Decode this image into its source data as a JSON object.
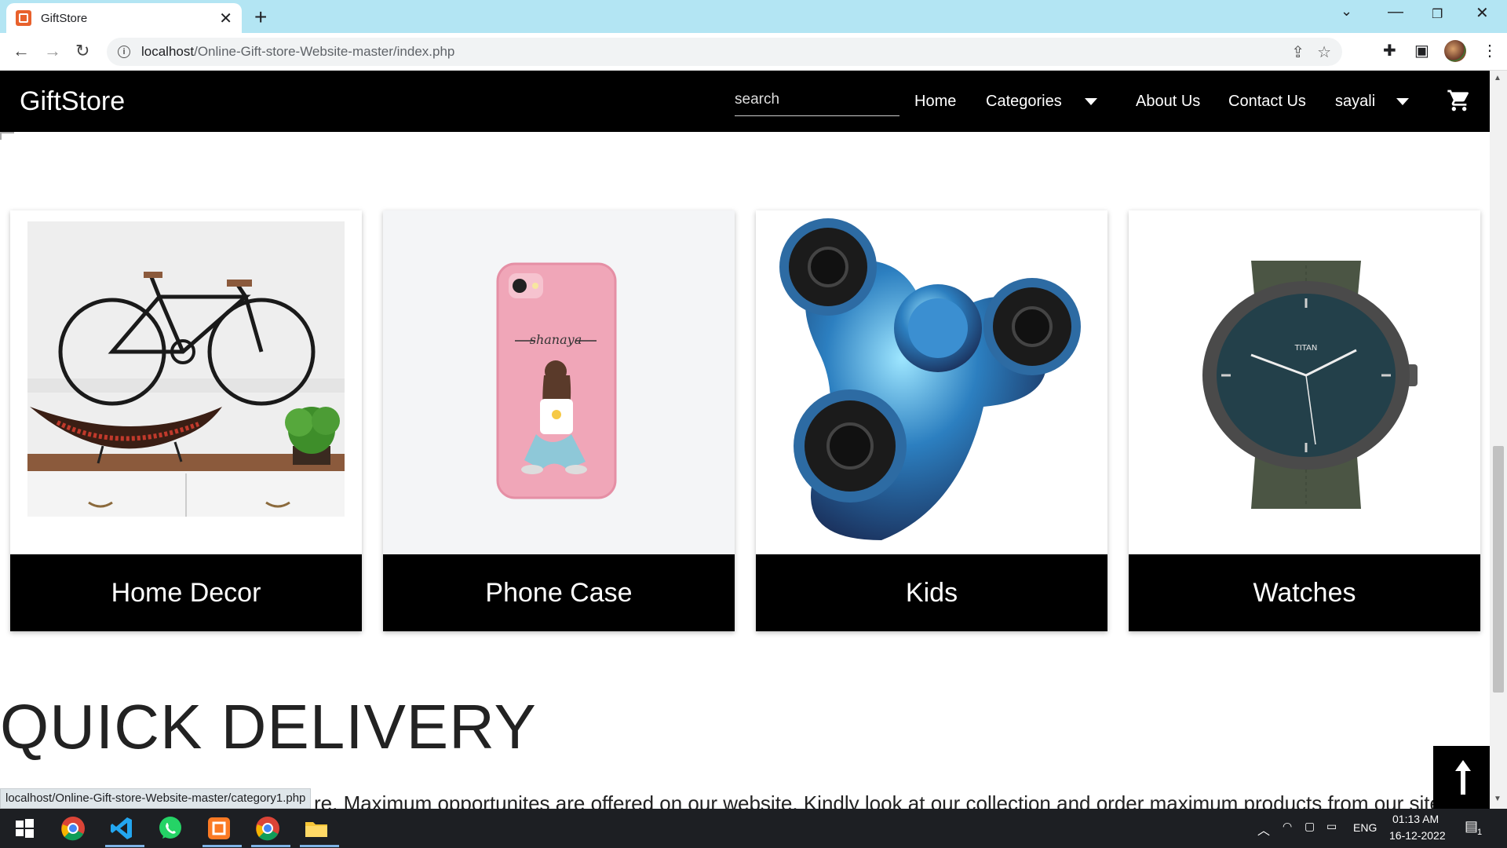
{
  "browser": {
    "tab_title": "GiftStore",
    "url_host": "localhost",
    "url_path": "/Online-Gift-store-Website-master/index.php",
    "status_url": "localhost/Online-Gift-store-Website-master/category1.php"
  },
  "nav": {
    "brand": "GiftStore",
    "search_placeholder": "search",
    "home": "Home",
    "categories": "Categories",
    "about": "About Us",
    "contact": "Contact Us",
    "user": "sayali"
  },
  "categories": [
    {
      "label": "Home Decor",
      "image": "bicycle-wall-decor"
    },
    {
      "label": "Phone Case",
      "image": "pink-phone-case"
    },
    {
      "label": "Kids",
      "image": "fidget-spinner"
    },
    {
      "label": "Watches",
      "image": "titan-watch"
    }
  ],
  "quick_delivery": {
    "title": "QUICK DELIVERY",
    "text_fragment_1": "re. Maximum opportunites are offered on our website. Kindly look at our collection and order maximum products from our site Sa"
  },
  "watch_brand": "TITAN",
  "phone_case_name": "shanaya",
  "taskbar": {
    "lang": "ENG",
    "time": "01:13 AM",
    "date": "16-12-2022",
    "notifications": "1"
  },
  "colors": {
    "tabbar": "#b3e5f3",
    "nav_bg": "#000000",
    "card_label_bg": "#000000",
    "taskbar": "#1d1f23"
  }
}
